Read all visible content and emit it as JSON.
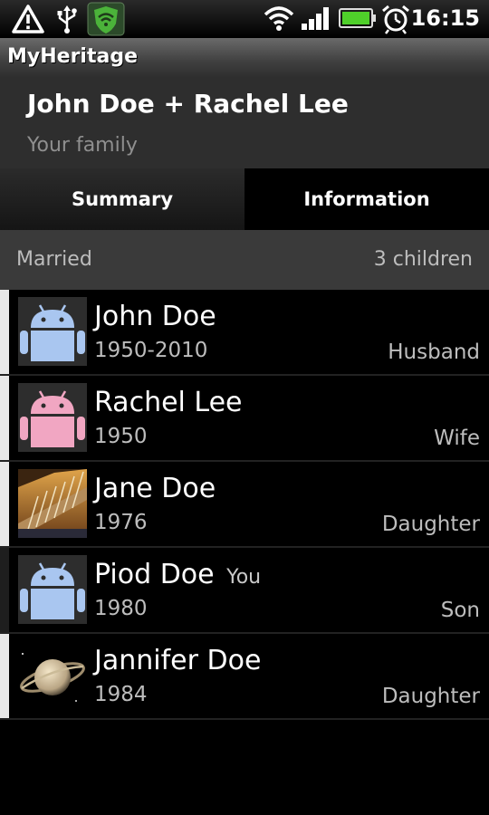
{
  "status_bar": {
    "time": "16:15",
    "icons": [
      "warning-icon",
      "usb-icon",
      "lookout-shield-icon",
      "wifi-icon",
      "signal-icon",
      "battery-icon",
      "alarm-icon"
    ]
  },
  "app": {
    "title": "MyHeritage"
  },
  "header": {
    "family_name": "John Doe + Rachel Lee",
    "subtitle": "Your family"
  },
  "tabs": [
    {
      "label": "Summary"
    },
    {
      "label": "Information"
    }
  ],
  "summary_strip": {
    "status": "Married",
    "children_count": "3 children"
  },
  "members": [
    {
      "name": "John Doe",
      "years": "1950-2010",
      "role": "Husband",
      "avatar": "android-blue-avatar"
    },
    {
      "name": "Rachel Lee",
      "years": "1950",
      "role": "Wife",
      "avatar": "android-pink-avatar"
    },
    {
      "name": "Jane Doe",
      "years": "1976",
      "role": "Daughter",
      "avatar": "architecture-photo-avatar"
    },
    {
      "name": "Piod Doe",
      "you": "You",
      "years": "1980",
      "role": "Son",
      "avatar": "android-blue-avatar"
    },
    {
      "name": "Jannifer Doe",
      "years": "1984",
      "role": "Daughter",
      "avatar": "saturn-photo-avatar"
    }
  ],
  "colors": {
    "android_blue": "#a9c6f0",
    "android_pink": "#f1a6c2",
    "lookout_green": "#4bb33a"
  }
}
